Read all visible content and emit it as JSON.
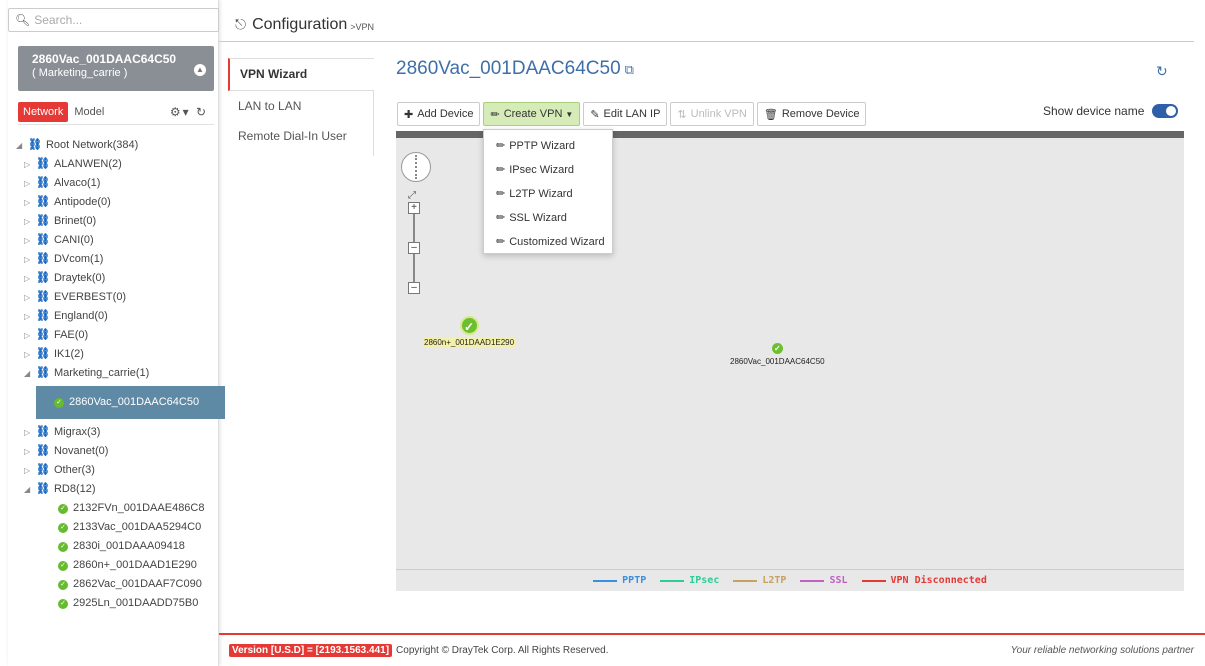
{
  "search": {
    "placeholder": "Search..."
  },
  "device_box": {
    "name": "2860Vac_001DAAC64C50",
    "group": "( Marketing_carrie )"
  },
  "sidebar_tabs": {
    "network": "Network",
    "model": "Model"
  },
  "tree": {
    "root": "Root Network(384)",
    "groups_top": [
      "ALANWEN(2)",
      "Alvaco(1)",
      "Antipode(0)",
      "Brinet(0)",
      "CANI(0)",
      "DVcom(1)",
      "Draytek(0)",
      "EVERBEST(0)",
      "England(0)",
      "FAE(0)",
      "IK1(2)"
    ],
    "marketing": "Marketing_carrie(1)",
    "selected_device": "2860Vac_001DAAC64C50",
    "groups_mid": [
      "Migrax(3)",
      "Novanet(0)",
      "Other(3)"
    ],
    "rd8": "RD8(12)",
    "rd8_devices": [
      "2132FVn_001DAAE486C8",
      "2133Vac_001DAA5294C0",
      "2830i_001DAAA09418",
      "2860n+_001DAAD1E290",
      "2862Vac_001DAAF7C090",
      "2925Ln_001DAADD75B0"
    ]
  },
  "header": {
    "title": "Configuration",
    "subtitle": ">VPN"
  },
  "submenu": {
    "items": [
      "VPN Wizard",
      "LAN to LAN",
      "Remote Dial-In User"
    ]
  },
  "content": {
    "device_title": "2860Vac_001DAAC64C50"
  },
  "toolbar": {
    "add_device": "Add Device",
    "create_vpn": "Create VPN",
    "edit_lan_ip": "Edit LAN IP",
    "unlink_vpn": "Unlink VPN",
    "remove_device": "Remove Device",
    "show_device_name": "Show device name"
  },
  "dropdown": {
    "items": [
      "PPTP Wizard",
      "IPsec Wizard",
      "L2TP Wizard",
      "SSL Wizard",
      "Customized Wizard"
    ]
  },
  "map_nodes": {
    "node1": "2860n+_001DAAD1E290",
    "node2": "2860Vac_001DAAC64C50"
  },
  "legend": [
    {
      "label": "PPTP",
      "color": "#3b8fe0"
    },
    {
      "label": "IPsec",
      "color": "#2ecc9a"
    },
    {
      "label": "L2TP",
      "color": "#c8a060"
    },
    {
      "label": "SSL",
      "color": "#c060c0"
    },
    {
      "label": "VPN Disconnected",
      "color": "#e53935"
    }
  ],
  "footer": {
    "version": "Version [U.S.D] = [2193.1563.441]",
    "copyright": "Copyright © DrayTek Corp. All Rights Reserved.",
    "tagline": "Your reliable networking solutions partner"
  },
  "colors": {
    "accent": "#e53935",
    "link": "#3f6fa8",
    "ok": "#66bb2f"
  }
}
